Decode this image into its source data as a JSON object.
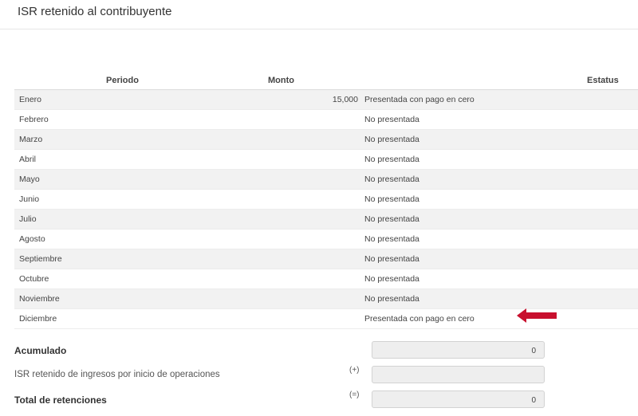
{
  "header": {
    "title": "ISR retenido al contribuyente"
  },
  "table": {
    "columns": {
      "periodo": "Periodo",
      "monto": "Monto",
      "estatus": "Estatus"
    },
    "rows": [
      {
        "periodo": "Enero",
        "monto": "15,000",
        "estatus": "Presentada con pago en cero"
      },
      {
        "periodo": "Febrero",
        "monto": "",
        "estatus": "No presentada"
      },
      {
        "periodo": "Marzo",
        "monto": "",
        "estatus": "No presentada"
      },
      {
        "periodo": "Abril",
        "monto": "",
        "estatus": "No presentada"
      },
      {
        "periodo": "Mayo",
        "monto": "",
        "estatus": "No presentada"
      },
      {
        "periodo": "Junio",
        "monto": "",
        "estatus": "No presentada"
      },
      {
        "periodo": "Julio",
        "monto": "",
        "estatus": "No presentada"
      },
      {
        "periodo": "Agosto",
        "monto": "",
        "estatus": "No presentada"
      },
      {
        "periodo": "Septiembre",
        "monto": "",
        "estatus": "No presentada"
      },
      {
        "periodo": "Octubre",
        "monto": "",
        "estatus": "No presentada"
      },
      {
        "periodo": "Noviembre",
        "monto": "",
        "estatus": "No presentada"
      },
      {
        "periodo": "Diciembre",
        "monto": "",
        "estatus": "Presentada con pago en cero"
      }
    ]
  },
  "annotation": {
    "icon": "arrow-left-icon",
    "color": "#c8102e"
  },
  "summary": {
    "acumulado": {
      "label": "Acumulado",
      "operator": "",
      "value": "0"
    },
    "inicio_operaciones": {
      "label": "ISR retenido de ingresos por inicio de operaciones",
      "operator": "(+)",
      "value": ""
    },
    "total": {
      "label": "Total de retenciones",
      "operator": "(=)",
      "value": "0"
    }
  }
}
